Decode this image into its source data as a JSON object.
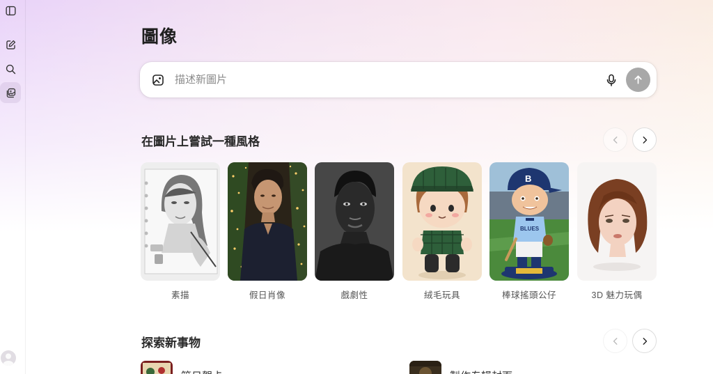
{
  "sidebar": {
    "toggle_icon": "sidebar-panel-icon",
    "new_chat_icon": "edit-pencil-icon",
    "search_icon": "search-icon",
    "images_icon": "image-library-icon",
    "avatar_icon": "user-avatar"
  },
  "page": {
    "title": "圖像"
  },
  "prompt": {
    "placeholder": "描述新圖片",
    "image_icon": "image-upload-icon",
    "mic_icon": "microphone-icon",
    "send_icon": "arrow-up-icon"
  },
  "styles_section": {
    "title": "在圖片上嘗試一種風格",
    "items": [
      {
        "label": "素描"
      },
      {
        "label": "假日肖像"
      },
      {
        "label": "戲劇性"
      },
      {
        "label": "絨毛玩具"
      },
      {
        "label": "棒球搖頭公仔"
      },
      {
        "label": "3D 魅力玩偶"
      }
    ]
  },
  "explore_section": {
    "title": "探索新事物",
    "items": [
      {
        "label": "節日賀卡"
      },
      {
        "label": "製作专辑封面"
      }
    ]
  },
  "colors": {
    "accent_send": "#a8a8a8",
    "background_top_left": "#e9d3f9",
    "background_top_right": "#fbeedf"
  }
}
